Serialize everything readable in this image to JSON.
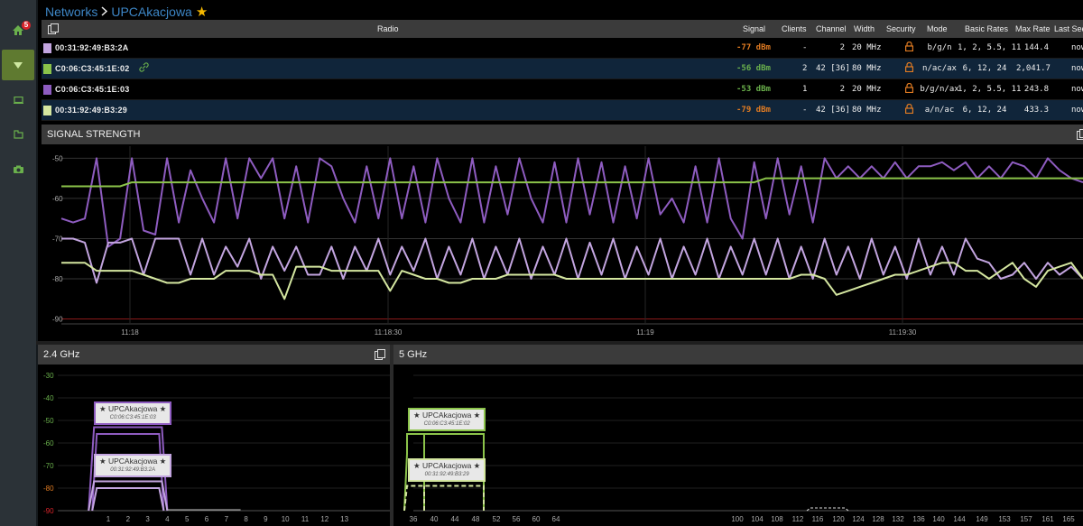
{
  "sidebar": {
    "home_badge": "5"
  },
  "breadcrumb": {
    "root": "Networks",
    "current": "UPCAkacjowa"
  },
  "table": {
    "headers": {
      "radio": "Radio",
      "signal": "Signal",
      "clients": "Clients",
      "channel": "Channel",
      "width": "Width",
      "security": "Security",
      "mode": "Mode",
      "basic_rates": "Basic Rates",
      "max_rate": "Max Rate",
      "last_seen": "Last Seen"
    },
    "rows": [
      {
        "color": "#c3a5e0",
        "mac": "00:31:92:49:B3:2A",
        "signal": "-77 dBm",
        "signal_color": "#e07b22",
        "clients": "-",
        "channel": "2",
        "width": "20 MHz",
        "mode": "b/g/n",
        "basic_rates": "1, 2, 5.5, 11",
        "max_rate": "144.4",
        "last_seen": "now"
      },
      {
        "color": "#8bc34a",
        "mac": "C0:06:C3:45:1E:02",
        "signal": "-56 dBm",
        "signal_color": "#6ab04c",
        "clients": "2",
        "channel": "42 [36]",
        "width": "80 MHz",
        "mode": "n/ac/ax",
        "basic_rates": "6, 12, 24",
        "max_rate": "2,041.7",
        "last_seen": "now"
      },
      {
        "color": "#8e5cc0",
        "mac": "C0:06:C3:45:1E:03",
        "signal": "-53 dBm",
        "signal_color": "#6ab04c",
        "clients": "1",
        "channel": "2",
        "width": "20 MHz",
        "mode": "b/g/n/ax",
        "basic_rates": "1, 2, 5.5, 11",
        "max_rate": "243.8",
        "last_seen": "now"
      },
      {
        "color": "#d4e6a0",
        "mac": "00:31:92:49:B3:29",
        "signal": "-79 dBm",
        "signal_color": "#e07b22",
        "clients": "-",
        "channel": "42 [36]",
        "width": "80 MHz",
        "mode": "a/n/ac",
        "basic_rates": "6, 12, 24",
        "max_rate": "433.3",
        "last_seen": "now"
      }
    ]
  },
  "signal_panel": {
    "title": "SIGNAL STRENGTH"
  },
  "panel_24": {
    "title": "2.4 GHz",
    "y_ticks": [
      "-30",
      "-40",
      "-50",
      "-60",
      "-70",
      "-80",
      "-90"
    ],
    "x_ticks": [
      "1",
      "2",
      "3",
      "4",
      "5",
      "6",
      "7",
      "8",
      "9",
      "10",
      "11",
      "12",
      "13"
    ]
  },
  "panel_5": {
    "title": "5 GHz",
    "x_ticks": [
      "36",
      "40",
      "44",
      "48",
      "52",
      "56",
      "60",
      "64",
      "100",
      "104",
      "108",
      "112",
      "116",
      "120",
      "124",
      "128",
      "132",
      "136",
      "140",
      "144",
      "149",
      "153",
      "157",
      "161",
      "165"
    ]
  },
  "ap_labels": {
    "ssid": "★ UPCAkacjowa ★",
    "a": "C0:06:C3:45:1E:03",
    "b": "00:31:92:49:B3:2A",
    "c": "C0:06:C3:45:1E:02",
    "d": "00:31:92:49:B3:29"
  },
  "chart_data": {
    "type": "line",
    "title": "SIGNAL STRENGTH",
    "x_ticks": [
      "11:18",
      "11:18:30",
      "11:19",
      "11:19:30"
    ],
    "y_ticks": [
      "-50",
      "-60",
      "-70",
      "-80",
      "-90"
    ],
    "ylim": [
      -91,
      -47
    ],
    "grid": true,
    "series": [
      {
        "color": "#8e5cc0",
        "values": [
          -65,
          -66,
          -65,
          -50,
          -72,
          -70,
          -50,
          -68,
          -69,
          -50,
          -66,
          -53,
          -60,
          -66,
          -50,
          -65,
          -50,
          -55,
          -50,
          -65,
          -52,
          -66,
          -50,
          -52,
          -60,
          -66,
          -52,
          -65,
          -50,
          -65,
          -52,
          -66,
          -50,
          -60,
          -66,
          -50,
          -66,
          -52,
          -64,
          -50,
          -60,
          -66,
          -51,
          -66,
          -50,
          -64,
          -51,
          -66,
          -52,
          -65,
          -50,
          -64,
          -60,
          -66,
          -52,
          -66,
          -50,
          -65,
          -70,
          -51,
          -65,
          -50,
          -64,
          -52,
          -66,
          -50,
          -55,
          -52,
          -55,
          -52,
          -55,
          -51,
          -55,
          -52,
          -52,
          -51,
          -53,
          -51,
          -55,
          -52,
          -55,
          -51,
          -52,
          -55,
          -50,
          -53,
          -55,
          -56
        ]
      },
      {
        "color": "#c3a5e0",
        "values": [
          -70,
          -70,
          -71,
          -81,
          -71,
          -71,
          -70,
          -79,
          -70,
          -70,
          -70,
          -79,
          -70,
          -79,
          -72,
          -77,
          -70,
          -80,
          -72,
          -78,
          -72,
          -79,
          -79,
          -72,
          -80,
          -72,
          -78,
          -70,
          -79,
          -72,
          -78,
          -70,
          -80,
          -72,
          -79,
          -70,
          -80,
          -72,
          -79,
          -70,
          -80,
          -72,
          -79,
          -70,
          -80,
          -71,
          -79,
          -70,
          -80,
          -72,
          -79,
          -70,
          -80,
          -72,
          -79,
          -70,
          -80,
          -72,
          -79,
          -70,
          -79,
          -70,
          -80,
          -72,
          -80,
          -70,
          -79,
          -72,
          -80,
          -70,
          -79,
          -72,
          -80,
          -70,
          -79,
          -72,
          -79,
          -70,
          -75,
          -76,
          -80,
          -79,
          -76,
          -80,
          -76,
          -79,
          -77,
          -80
        ]
      },
      {
        "color": "#8bc34a",
        "values": [
          -57,
          -57,
          -57,
          -57,
          -57,
          -57,
          -56,
          -56,
          -56,
          -56,
          -56,
          -56,
          -56,
          -56,
          -56,
          -56,
          -56,
          -56,
          -56,
          -56,
          -56,
          -56,
          -56,
          -56,
          -56,
          -56,
          -56,
          -56,
          -56,
          -56,
          -56,
          -56,
          -56,
          -56,
          -56,
          -56,
          -56,
          -56,
          -56,
          -56,
          -56,
          -56,
          -56,
          -56,
          -56,
          -56,
          -56,
          -56,
          -56,
          -56,
          -56,
          -56,
          -56,
          -56,
          -56,
          -56,
          -56,
          -56,
          -56,
          -56,
          -55,
          -55,
          -55,
          -55,
          -55,
          -55,
          -55,
          -55,
          -55,
          -55,
          -55,
          -55,
          -55,
          -55,
          -55,
          -55,
          -55,
          -55,
          -55,
          -55,
          -55,
          -55,
          -55,
          -55,
          -55,
          -55,
          -55,
          -55
        ]
      },
      {
        "color": "#d4e6a0",
        "values": [
          -76,
          -76,
          -76,
          -78,
          -78,
          -78,
          -78,
          -79,
          -80,
          -81,
          -81,
          -80,
          -80,
          -80,
          -78,
          -78,
          -78,
          -79,
          -79,
          -85,
          -77,
          -77,
          -77,
          -78,
          -78,
          -78,
          -78,
          -78,
          -83,
          -78,
          -79,
          -80,
          -80,
          -81,
          -81,
          -80,
          -80,
          -80,
          -79,
          -79,
          -79,
          -79,
          -79,
          -80,
          -80,
          -80,
          -80,
          -80,
          -80,
          -80,
          -80,
          -80,
          -80,
          -80,
          -80,
          -80,
          -80,
          -80,
          -80,
          -80,
          -80,
          -80,
          -80,
          -79,
          -79,
          -80,
          -84,
          -83,
          -82,
          -81,
          -80,
          -79,
          -79,
          -78,
          -77,
          -76,
          -76,
          -78,
          -78,
          -80,
          -78,
          -76,
          -80,
          -82,
          -78,
          -77,
          -76,
          -80
        ]
      }
    ]
  }
}
